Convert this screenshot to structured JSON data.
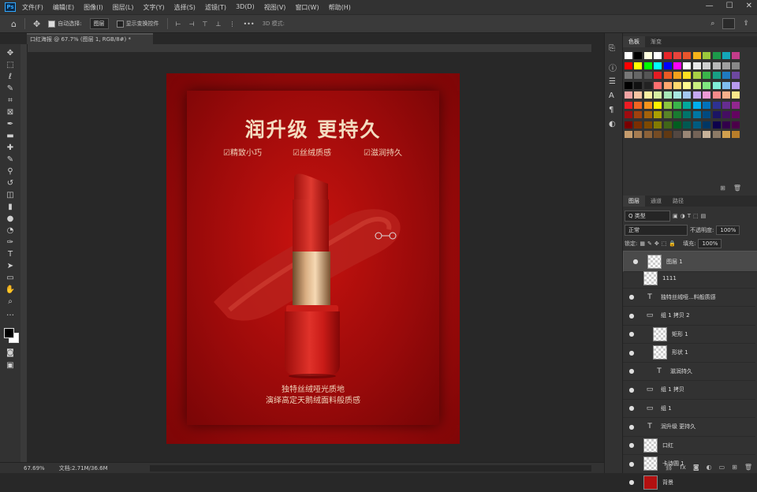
{
  "app": {
    "logo": "Ps"
  },
  "menu": [
    "文件(F)",
    "编辑(E)",
    "图像(I)",
    "图层(L)",
    "文字(Y)",
    "选择(S)",
    "滤镜(T)",
    "3D(D)",
    "视图(V)",
    "窗口(W)",
    "帮助(H)"
  ],
  "window_controls": [
    "—",
    "☐",
    "✕"
  ],
  "options": {
    "auto_select_label": "自动选择:",
    "auto_select_value": "图层",
    "transform_label": "显示变换控件",
    "mode_3d": "3D 模式:",
    "more": "•••"
  },
  "document_tab": "口红海报 @ 67.7% (图层 1, RGB/8#) *",
  "poster": {
    "headline": "润升级 更持久",
    "features": [
      "☑精致小巧",
      "☑丝绒质感",
      "☑滋润持久"
    ],
    "tagline1": "独特丝绒哑光质地",
    "tagline2": "演绎高定天鹅绒面料般质感"
  },
  "status": {
    "zoom": "67.69%",
    "doc": "文档:2.71M/36.6M"
  },
  "panels": {
    "swatch_tabs": [
      "色板",
      "渐变"
    ],
    "layer_tabs": [
      "图层",
      "通道",
      "路径"
    ],
    "filter_kind": "Q 类型",
    "blend_mode": "正常",
    "opacity_label": "不透明度:",
    "opacity_value": "100%",
    "lock_label": "锁定:",
    "fill_label": "填充:",
    "fill_value": "100%"
  },
  "layers": [
    {
      "name": "图层 1",
      "thumb": "pix",
      "selected": true,
      "eye": true,
      "indent": 0
    },
    {
      "name": "1111",
      "thumb": "pix",
      "selected": false,
      "eye": false,
      "indent": 0
    },
    {
      "name": "独特丝绒哑...料般质感",
      "thumb": "T",
      "selected": false,
      "eye": true,
      "indent": 0
    },
    {
      "name": "组 1 拷贝 2",
      "thumb": "folder",
      "selected": false,
      "eye": true,
      "indent": 0
    },
    {
      "name": "矩形 1",
      "thumb": "pix",
      "selected": false,
      "eye": true,
      "indent": 1
    },
    {
      "name": "形状 1",
      "thumb": "pix",
      "selected": false,
      "eye": true,
      "indent": 1
    },
    {
      "name": "滋润持久",
      "thumb": "T",
      "selected": false,
      "eye": true,
      "indent": 1
    },
    {
      "name": "组 1 拷贝",
      "thumb": "folder",
      "selected": false,
      "eye": true,
      "indent": 0
    },
    {
      "name": "组 1",
      "thumb": "folder",
      "selected": false,
      "eye": true,
      "indent": 0
    },
    {
      "name": "润升级 更持久",
      "thumb": "T",
      "selected": false,
      "eye": true,
      "indent": 0
    },
    {
      "name": "口红",
      "thumb": "pix",
      "selected": false,
      "eye": true,
      "indent": 0
    },
    {
      "name": "卡诗圆 1",
      "thumb": "pix",
      "selected": false,
      "eye": true,
      "indent": 0
    },
    {
      "name": "背景",
      "thumb": "red",
      "selected": false,
      "eye": true,
      "indent": 0
    }
  ],
  "colors": {
    "accent": "#31a8ff",
    "poster_red": "#a50c0c",
    "headline": "#f3dcc0"
  },
  "swatch_colors": [
    [
      "#ffffff",
      "#000000",
      "#ffffe0",
      "#ffffff",
      "#e8262a",
      "#e8433c",
      "#e9542c",
      "#f5b31a",
      "#9bc83b",
      "#1c9a4a",
      "#14a7b8",
      "#c43c8a"
    ],
    [
      "#ff0000",
      "#ffff00",
      "#00ff00",
      "#00ffff",
      "#0000ff",
      "#ff00ff",
      "#ffffff",
      "#e8e8e8",
      "#d0d0d0",
      "#b8b8b8",
      "#a0a0a0",
      "#888888"
    ],
    [
      "#777777",
      "#666666",
      "#555555",
      "#e51c23",
      "#ea5b24",
      "#f3a21c",
      "#fee021",
      "#a8cf45",
      "#3ab54a",
      "#18a085",
      "#1f7ac0",
      "#6d48a0"
    ],
    [
      "#000000",
      "#111111",
      "#222222",
      "#ff6f6f",
      "#ffa86f",
      "#ffd96f",
      "#fffc8f",
      "#c8ee7f",
      "#7fe77f",
      "#7feed8",
      "#7fbdf0",
      "#b89aee"
    ],
    [
      "#f2a3a3",
      "#f7c4a3",
      "#faf0a3",
      "#d8f0a3",
      "#a8e8b8",
      "#a8e8e2",
      "#a3c8f2",
      "#c4a8f2",
      "#ee9ad6",
      "#f58a8a",
      "#f6b08a",
      "#f8e78a"
    ],
    [
      "#ed1c24",
      "#f26522",
      "#f7941d",
      "#fff200",
      "#8dc63f",
      "#39b54a",
      "#00a99d",
      "#00aeef",
      "#0072bc",
      "#2e3192",
      "#662d91",
      "#92278f"
    ],
    [
      "#9e0b0f",
      "#a0410d",
      "#a3620a",
      "#aba000",
      "#598527",
      "#197b30",
      "#00746b",
      "#0076a3",
      "#004a80",
      "#1b1464",
      "#440e62",
      "#630460"
    ],
    [
      "#790000",
      "#7b2e00",
      "#7d4900",
      "#827b00",
      "#406618",
      "#005e20",
      "#005952",
      "#005b7f",
      "#003663",
      "#0d004c",
      "#32004b",
      "#4b0049"
    ],
    [
      "#c69c6d",
      "#a67c52",
      "#8c6239",
      "#754c24",
      "#603913",
      "#534741",
      "#998675",
      "#736357",
      "#c7b299",
      "#8c7a66",
      "#d2a04e",
      "#b87d2a"
    ]
  ]
}
